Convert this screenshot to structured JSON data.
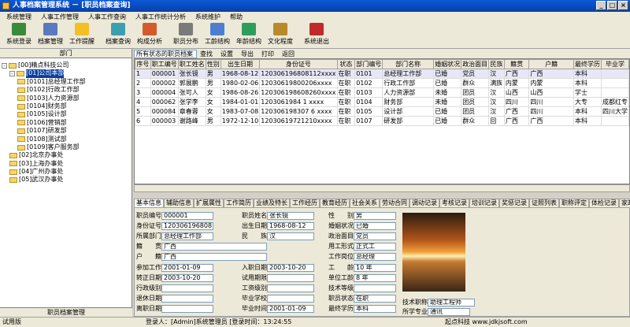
{
  "window": {
    "title": "人事档案管理系统 － [职员档案查询]"
  },
  "menu": [
    "系统管理",
    "人事工作管理",
    "人事工作查询",
    "人事工作统计分析",
    "系统维护",
    "帮助"
  ],
  "toolbar": [
    {
      "label": "系统登录",
      "icon": "login-icon",
      "color": "#3a8a3a"
    },
    {
      "label": "档案管理",
      "icon": "archive-icon",
      "color": "#5a7abf"
    },
    {
      "label": "工作提醒",
      "icon": "bell-icon",
      "color": "#f2c025"
    },
    {
      "label": "档案查询",
      "icon": "search-icon",
      "color": "#3aa0b0"
    },
    {
      "label": "构成分析",
      "icon": "pie-icon",
      "color": "#d45a2a"
    },
    {
      "label": "职员分布",
      "icon": "people-icon",
      "color": "#7a7a7a"
    },
    {
      "label": "工龄结构",
      "icon": "clock-icon",
      "color": "#4b7ed0"
    },
    {
      "label": "年龄结构",
      "icon": "chart-icon",
      "color": "#2d9d5b"
    },
    {
      "label": "文化程度",
      "icon": "book-icon",
      "color": "#b88a2a"
    },
    {
      "label": "系统退出",
      "icon": "exit-icon",
      "color": "#c02a2a"
    }
  ],
  "tree": {
    "header": "职员档案管理",
    "nodes": [
      {
        "label": "[00]精点科技公司",
        "level": 0,
        "expand": "-"
      },
      {
        "label": "[01]公司本部",
        "level": 1,
        "expand": "-",
        "selected": true
      },
      {
        "label": "[0101]总经理工作部",
        "level": 2
      },
      {
        "label": "[0102]行政工作部",
        "level": 2
      },
      {
        "label": "[0103]人力资源部",
        "level": 2
      },
      {
        "label": "[0104]财务部",
        "level": 2
      },
      {
        "label": "[0105]设计部",
        "level": 2
      },
      {
        "label": "[0106]营销部",
        "level": 2
      },
      {
        "label": "[0107]研发部",
        "level": 2
      },
      {
        "label": "[0108]测试部",
        "level": 2
      },
      {
        "label": "[0109]客户服务部",
        "level": 2
      },
      {
        "label": "[02]北京办事处",
        "level": 1
      },
      {
        "label": "[03]上海办事处",
        "level": 1
      },
      {
        "label": "[04]广州办事处",
        "level": 1
      },
      {
        "label": "[05]武汉办事处",
        "level": 1
      }
    ]
  },
  "query": {
    "select": "所有状态的职员档案",
    "find": "查找",
    "setup": "设置",
    "export": "导出",
    "print": "打印",
    "back": "返回"
  },
  "grid": {
    "columns": [
      "序号",
      "职工编号",
      "职工姓名",
      "性别",
      "出生日期",
      "身份证号",
      "状态",
      "部门编号",
      "部门名称",
      "婚姻状况",
      "政治面目",
      "民族",
      "籍贯",
      "户籍",
      "最终学历",
      "毕业学"
    ],
    "widths": [
      20,
      32,
      32,
      14,
      46,
      72,
      24,
      30,
      70,
      30,
      30,
      20,
      36,
      70,
      30,
      34
    ],
    "rows": [
      [
        "1",
        "000001",
        "张长镜",
        "男",
        "1968-08-12",
        "120306196808112xxxx",
        "在职",
        "0101",
        "总经理工作部",
        "已婚",
        "党员",
        "汉",
        "广西",
        "广西",
        "本科",
        ""
      ],
      [
        "2",
        "000002",
        "郭展鹏",
        "男",
        "1980-02-06",
        "12030619800206xxxx",
        "在职",
        "0102",
        "行政工作部",
        "已婚",
        "群众",
        "满族",
        "内蒙",
        "内蒙",
        "本科",
        ""
      ],
      [
        "3",
        "000004",
        "张可人",
        "女",
        "1986-08-26",
        "120306198608260xxxx",
        "在职",
        "0103",
        "人力资源部",
        "未婚",
        "团员",
        "汉",
        "山西",
        "山西",
        "学士",
        ""
      ],
      [
        "4",
        "000062",
        "张学李",
        "女",
        "1984-01-01",
        "1203061984 1 xxxx",
        "在职",
        "0104",
        "财务部",
        "未婚",
        "团员",
        "汉",
        "四川",
        "四川",
        "大专",
        "成都红专"
      ],
      [
        "5",
        "000084",
        "章春蓉",
        "女",
        "1983-07-08",
        "120306198307 6 xxxx",
        "在职",
        "0105",
        "设计部",
        "已婚",
        "团员",
        "汉",
        "广西",
        "四川",
        "本科",
        "四川大学"
      ],
      [
        "6",
        "000003",
        "谢路峰",
        "男",
        "1972-12-10",
        "12030619721210xxxx",
        "在职",
        "0107",
        "研发部",
        "已婚",
        "群众",
        "回",
        "广西",
        "广西",
        "本科",
        ""
      ]
    ]
  },
  "tabs": [
    "基本信息",
    "辅助信息",
    "扩展属性",
    "工作简历",
    "业绩及特长",
    "工作经历",
    "教育经历",
    "社会关系",
    "劳动合同",
    "调动记录",
    "考核记录",
    "培训记录",
    "奖惩记录",
    "证照列表",
    "职称评定",
    "体检记录",
    "家政"
  ],
  "detail": {
    "fields": [
      {
        "label": "职员编号",
        "value": "000001"
      },
      {
        "label": "职员姓名",
        "value": "张长镜"
      },
      {
        "label": "性　　别",
        "value": "男"
      },
      {
        "label": "身份证号",
        "value": "120306196808112xxxx"
      },
      {
        "label": "出生日期",
        "value": "1968-08-12"
      },
      {
        "label": "婚姻状况",
        "value": "已婚"
      },
      {
        "label": "所属部门",
        "value": "总经理工作部"
      },
      {
        "label": "民　　族",
        "value": "汉"
      },
      {
        "label": "政治面目",
        "value": "党员"
      },
      {
        "label": "籍　　贯",
        "value": "广西"
      },
      {
        "label": "用工形式",
        "value": "正式工"
      },
      {
        "label": "户　　籍",
        "value": "广西"
      },
      {
        "label": "工作岗位",
        "value": "总经理"
      },
      {
        "label": "参加工作",
        "value": "2001-01-09"
      },
      {
        "label": "入职日期",
        "value": "2003-10-20"
      },
      {
        "label": "工　　龄",
        "value": "10 年"
      },
      {
        "label": "转正日期",
        "value": "2003-10-20"
      },
      {
        "label": "试用期限",
        "value": ""
      },
      {
        "label": "单位工龄",
        "value": "8 年"
      },
      {
        "label": "行政级别",
        "value": ""
      },
      {
        "label": "工资级别",
        "value": ""
      },
      {
        "label": "技术等级",
        "value": ""
      },
      {
        "label": "退休日期",
        "value": ""
      },
      {
        "label": "毕业学校",
        "value": ""
      },
      {
        "label": "离职日期",
        "value": ""
      },
      {
        "label": "毕业时间",
        "value": "2001-01-09"
      },
      {
        "label": "最终学历",
        "value": "本科"
      },
      {
        "label": "技术职称",
        "value": "助理工程师"
      },
      {
        "label": "所学专业",
        "value": "通讯"
      },
      {
        "label": "职员状态",
        "value": "在职"
      }
    ]
  },
  "status": {
    "left": "试用版",
    "login": "登录人：[Admin]系统管理员 [登录时间：13:24:55",
    "right": "起点科技 www.jdkjsoft.com"
  }
}
